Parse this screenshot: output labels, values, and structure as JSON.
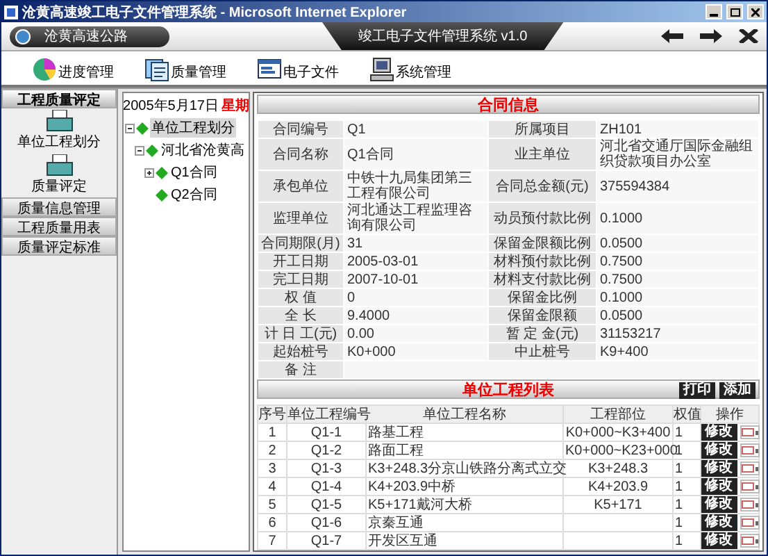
{
  "window": {
    "title": "沧黄高速竣工电子文件管理系统 - Microsoft Internet Explorer"
  },
  "header": {
    "road": "沧黄高速公路",
    "system": "竣工电子文件管理系统 v1.0"
  },
  "toolbar": [
    "进度管理",
    "质量管理",
    "电子文件",
    "系统管理"
  ],
  "sidebar": [
    {
      "label": "工程质量评定",
      "expanded": true,
      "items": [
        "单位工程划分",
        "质量评定"
      ]
    },
    {
      "label": "质量信息管理",
      "expanded": false
    },
    {
      "label": "工程质量用表",
      "expanded": false
    },
    {
      "label": "质量评定标准",
      "expanded": false
    }
  ],
  "tree_panel": {
    "date": "2005年5月17日",
    "weekday": "星期",
    "nodes": [
      {
        "label": "单位工程划分",
        "expanded": true,
        "selected": true,
        "children": [
          {
            "label": "河北省沧黄高",
            "expanded": true,
            "selected": false,
            "children": [
              {
                "label": "Q1合同",
                "expanded": false,
                "selected": false
              },
              {
                "label": "Q2合同",
                "selected": false
              }
            ]
          }
        ]
      }
    ]
  },
  "contract": {
    "title": "合同信息",
    "rows": [
      [
        "合同编号",
        "Q1",
        "所属项目",
        "ZH101"
      ],
      [
        "合同名称",
        "Q1合同",
        "业主单位",
        "河北省交通厅国际金融组织贷款项目办公室"
      ],
      [
        "承包单位",
        "中铁十九局集团第三工程有限公司",
        "合同总金额(元)",
        "375594384"
      ],
      [
        "监理单位",
        "河北通达工程监理咨询有限公司",
        "动员预付款比例",
        "0.1000"
      ],
      [
        "合同期限(月)",
        "31",
        "保留金限额比例",
        "0.0500"
      ],
      [
        "开工日期",
        "2005-03-01",
        "材料预付款比例",
        "0.7500"
      ],
      [
        "完工日期",
        "2007-10-01",
        "材料支付款比例",
        "0.7500"
      ],
      [
        "权 值",
        "0",
        "保留金比例",
        "0.1000"
      ],
      [
        "全 长",
        "9.4000",
        "保留金限额",
        "0.0500"
      ],
      [
        "计 日 工(元)",
        "0.00",
        "暂 定 金(元)",
        "31153217"
      ],
      [
        "起始桩号",
        "K0+000",
        "中止桩号",
        "K9+400"
      ],
      [
        "备 注"
      ]
    ]
  },
  "unit_list": {
    "title": "单位工程列表",
    "buttons": [
      "打印",
      "添加"
    ],
    "columns": [
      "序号",
      "单位工程编号",
      "单位工程名称",
      "工程部位",
      "权值",
      "操作"
    ],
    "rows": [
      {
        "no": "1",
        "code": "Q1-1",
        "name": "路基工程",
        "section": "K0+000~K3+400",
        "weight": "1",
        "action": "修改"
      },
      {
        "no": "2",
        "code": "Q1-2",
        "name": "路面工程",
        "section": "K0+000~K23+000",
        "weight": "1",
        "action": "修改"
      },
      {
        "no": "3",
        "code": "Q1-3",
        "name": "K3+248.3分京山铁路分离式立交",
        "section": "K3+248.3",
        "weight": "1",
        "action": "修改"
      },
      {
        "no": "4",
        "code": "Q1-4",
        "name": "K4+203.9中桥",
        "section": "K4+203.9",
        "weight": "1",
        "action": "修改"
      },
      {
        "no": "5",
        "code": "Q1-5",
        "name": "K5+171戴河大桥",
        "section": "K5+171",
        "weight": "1",
        "action": "修改"
      },
      {
        "no": "6",
        "code": "Q1-6",
        "name": "京秦互通",
        "weight": "1",
        "action": "修改"
      },
      {
        "no": "7",
        "code": "Q1-7",
        "name": "开发区互通",
        "weight": "1",
        "action": "修改"
      }
    ]
  }
}
